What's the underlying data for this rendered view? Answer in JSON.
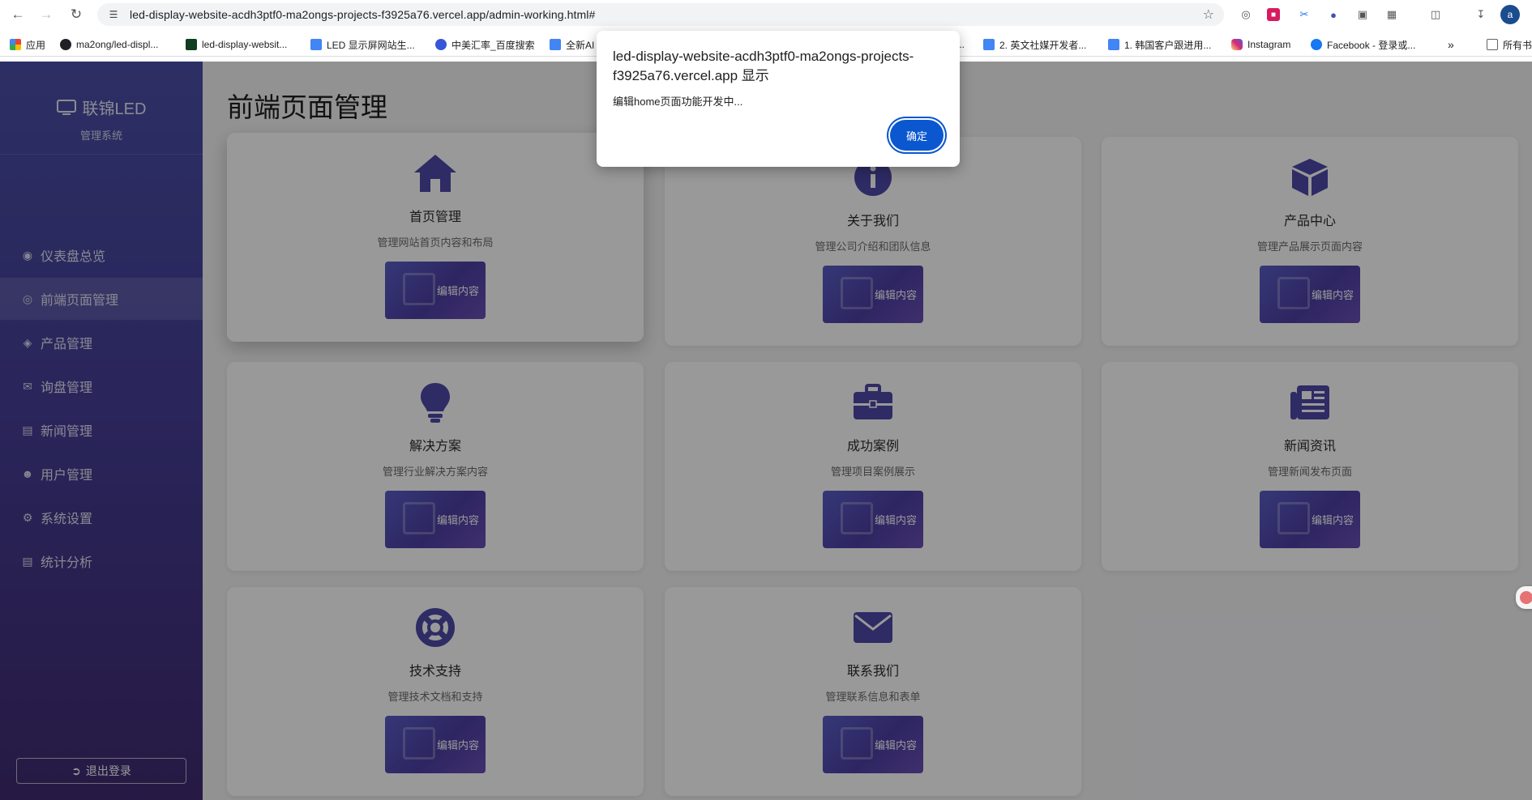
{
  "browser": {
    "url": "led-display-website-acdh3ptf0-ma2ongs-projects-f3925a76.vercel.app/admin-working.html#",
    "profile_initial": "a",
    "bookmarks": [
      {
        "label": "应用",
        "icon": "apps-grid-icon",
        "color": "#e8453c"
      },
      {
        "label": "ma2ong/led-displ...",
        "icon": "github-icon",
        "color": "#202124"
      },
      {
        "label": "led-display-websit...",
        "icon": "vercel-icon",
        "color": "#1e8e3e"
      },
      {
        "label": "LED 显示屏网站生...",
        "icon": "doc-icon",
        "color": "#4285f4"
      },
      {
        "label": "中美汇率_百度搜索",
        "icon": "baidu-icon",
        "color": "#3556d6"
      },
      {
        "label": "全新AI",
        "icon": "doc-icon",
        "color": "#4285f4"
      },
      {
        "label": "...",
        "icon": "",
        "color": ""
      },
      {
        "label": "2. 英文社媒开发者...",
        "icon": "doc-icon",
        "color": "#4285f4"
      },
      {
        "label": "1. 韩国客户跟进用...",
        "icon": "doc-icon",
        "color": "#4285f4"
      },
      {
        "label": "Instagram",
        "icon": "instagram-icon",
        "color": "#d6249f"
      },
      {
        "label": "Facebook - 登录或...",
        "icon": "facebook-icon",
        "color": "#1877f2"
      },
      {
        "label": "»",
        "icon": "",
        "color": ""
      },
      {
        "label": "所有书",
        "icon": "folder-icon",
        "color": "#5f6368"
      }
    ]
  },
  "sidebar": {
    "brand": "联锦LED",
    "subtitle": "管理系统",
    "items": [
      {
        "label": "仪表盘总览",
        "icon": "dashboard-icon"
      },
      {
        "label": "前端页面管理",
        "icon": "globe-icon",
        "active": true
      },
      {
        "label": "产品管理",
        "icon": "box-icon"
      },
      {
        "label": "询盘管理",
        "icon": "mail-icon"
      },
      {
        "label": "新闻管理",
        "icon": "newspaper-icon"
      },
      {
        "label": "用户管理",
        "icon": "users-icon"
      },
      {
        "label": "系统设置",
        "icon": "gear-icon"
      },
      {
        "label": "统计分析",
        "icon": "chart-icon"
      }
    ],
    "logout": "退出登录"
  },
  "main": {
    "title": "前端页面管理",
    "button_label": "编辑内容",
    "cards": [
      {
        "title": "首页管理",
        "desc": "管理网站首页内容和布局",
        "icon": "home-icon"
      },
      {
        "title": "关于我们",
        "desc": "管理公司介绍和团队信息",
        "icon": "info-icon"
      },
      {
        "title": "产品中心",
        "desc": "管理产品展示页面内容",
        "icon": "cube-icon"
      },
      {
        "title": "解决方案",
        "desc": "管理行业解决方案内容",
        "icon": "lightbulb-icon"
      },
      {
        "title": "成功案例",
        "desc": "管理项目案例展示",
        "icon": "briefcase-icon"
      },
      {
        "title": "新闻资讯",
        "desc": "管理新闻发布页面",
        "icon": "newspaper-icon"
      },
      {
        "title": "技术支持",
        "desc": "管理技术文档和支持",
        "icon": "lifering-icon"
      },
      {
        "title": "联系我们",
        "desc": "管理联系信息和表单",
        "icon": "envelope-icon"
      }
    ]
  },
  "dialog": {
    "origin": "led-display-website-acdh3ptf0-ma2ongs-projects-f3925a76.vercel.app 显示",
    "message": "编辑home页面功能开发中...",
    "ok": "确定"
  },
  "colors": {
    "accent": "#4b4cae",
    "icon_color": "#4d48a8",
    "dialog_button": "#0b57d0"
  }
}
